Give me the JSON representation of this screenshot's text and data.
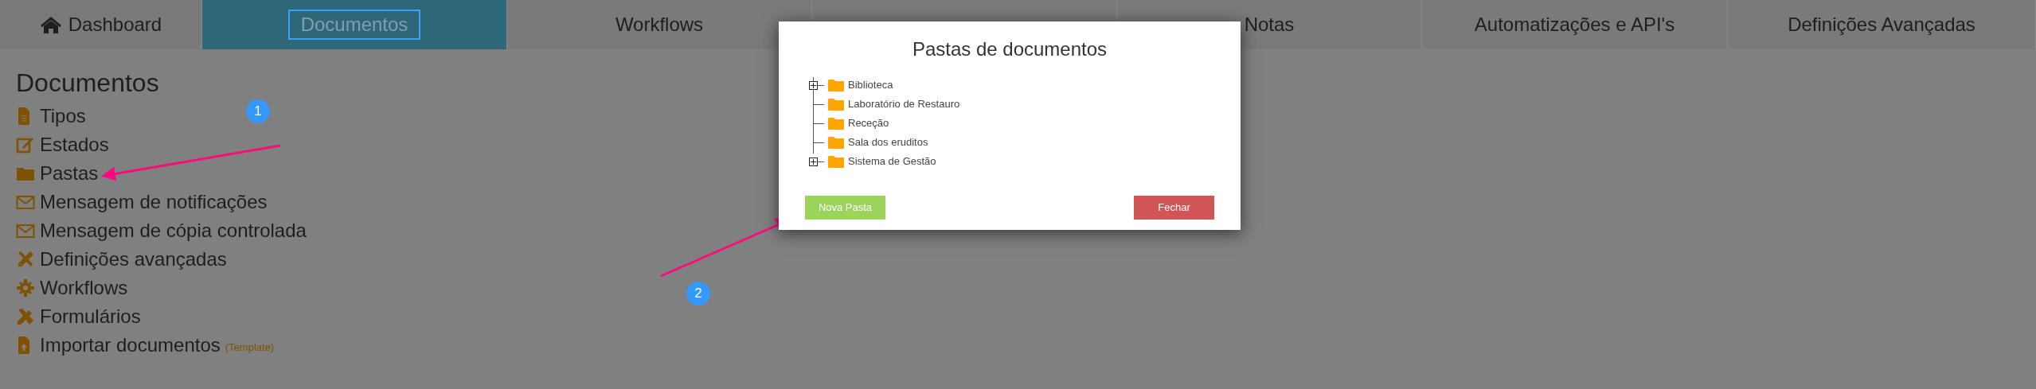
{
  "nav": {
    "tabs": [
      {
        "label": "Dashboard",
        "selected": false
      },
      {
        "label": "Documentos",
        "selected": true
      },
      {
        "label": "Workflows",
        "selected": false
      },
      {
        "selected": false
      },
      {
        "label": "Notas",
        "selected": false
      },
      {
        "label": "Automatizações e API's",
        "selected": false
      },
      {
        "label": "Definições Avançadas",
        "selected": false
      }
    ]
  },
  "sidebar": {
    "title": "Documentos",
    "items": [
      {
        "label": "Tipos"
      },
      {
        "label": "Estados"
      },
      {
        "label": "Pastas"
      },
      {
        "label": "Mensagem de notificações"
      },
      {
        "label": "Mensagem de cópia controlada"
      },
      {
        "label": "Definições avançadas"
      },
      {
        "label": "Workflows"
      },
      {
        "label": "Formulários"
      },
      {
        "label": "Importar documentos",
        "tag": "(Template)"
      }
    ]
  },
  "annotations": [
    {
      "number": "1"
    },
    {
      "number": "2"
    }
  ],
  "dialog": {
    "title": "Pastas de documentos",
    "tree": [
      {
        "label": "Biblioteca",
        "expanded": false
      },
      {
        "label": "Laboratório de Restauro"
      },
      {
        "label": "Receção"
      },
      {
        "label": "Sala dos eruditos"
      },
      {
        "label": "Sistema de Gestão",
        "expanded": false
      }
    ],
    "buttons": [
      {
        "label": "Nova Pasta",
        "kind": "primary"
      },
      {
        "label": "Fechar",
        "kind": "danger"
      }
    ]
  }
}
